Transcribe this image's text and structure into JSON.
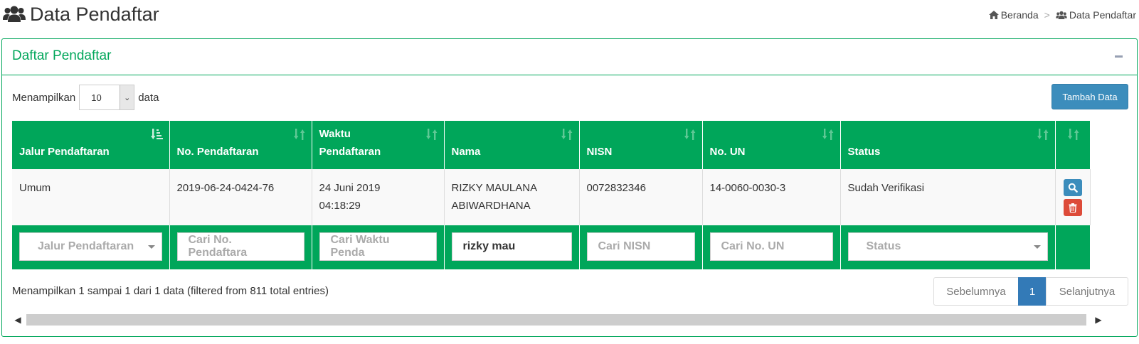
{
  "header": {
    "title": "Data Pendaftar",
    "title_icon": "users-icon"
  },
  "breadcrumb": {
    "items": [
      {
        "label": "Beranda",
        "icon": "home-icon"
      },
      {
        "label": "Data Pendaftar",
        "icon": "users-icon"
      }
    ],
    "separator": ">"
  },
  "box": {
    "title": "Daftar Pendaftar",
    "accent_color": "#00a65a"
  },
  "length": {
    "prefix": "Menampilkan",
    "value": "10",
    "suffix": "data"
  },
  "add_button": {
    "label": "Tambah Data"
  },
  "table": {
    "columns": [
      {
        "line1": "",
        "line2": "Jalur Pendaftaran",
        "sort": "sort-desc-icon"
      },
      {
        "line1": "",
        "line2": "No. Pendaftaran",
        "sort": "sort-icon"
      },
      {
        "line1": "Waktu",
        "line2": "Pendaftaran",
        "sort": "sort-icon"
      },
      {
        "line1": "",
        "line2": "Nama",
        "sort": "sort-icon"
      },
      {
        "line1": "",
        "line2": "NISN",
        "sort": "sort-icon"
      },
      {
        "line1": "",
        "line2": "No. UN",
        "sort": "sort-icon"
      },
      {
        "line1": "",
        "line2": "Status",
        "sort": "sort-icon"
      },
      {
        "line1": "",
        "line2": "",
        "sort": "sort-icon"
      }
    ],
    "rows": [
      {
        "jalur": "Umum",
        "no_pendaftaran": "2019-06-24-0424-76",
        "waktu_line1": "24 Juni 2019",
        "waktu_line2": "04:18:29",
        "nama_line1": "RIZKY MAULANA",
        "nama_line2": "ABIWARDHANA",
        "nisn": "0072832346",
        "no_un": "14-0060-0030-3",
        "status": "Sudah Verifikasi"
      }
    ],
    "filters": {
      "jalur": "Jalur Pendaftaran",
      "no_pendaftaran": "Cari No. Pendaftara",
      "waktu": "Cari Waktu Penda",
      "nama_value": "rizky mau",
      "nisn": "Cari NISN",
      "no_un": "Cari No. UN",
      "status": "Status"
    }
  },
  "info": "Menampilkan 1 sampai 1 dari 1 data (filtered from 811 total entries)",
  "pagination": {
    "prev": "Sebelumnya",
    "current": "1",
    "next": "Selanjutnya"
  },
  "colors": {
    "primary": "#3c8dbc",
    "danger": "#dd4b39",
    "success": "#00a65a",
    "page_active": "#337ab7"
  }
}
